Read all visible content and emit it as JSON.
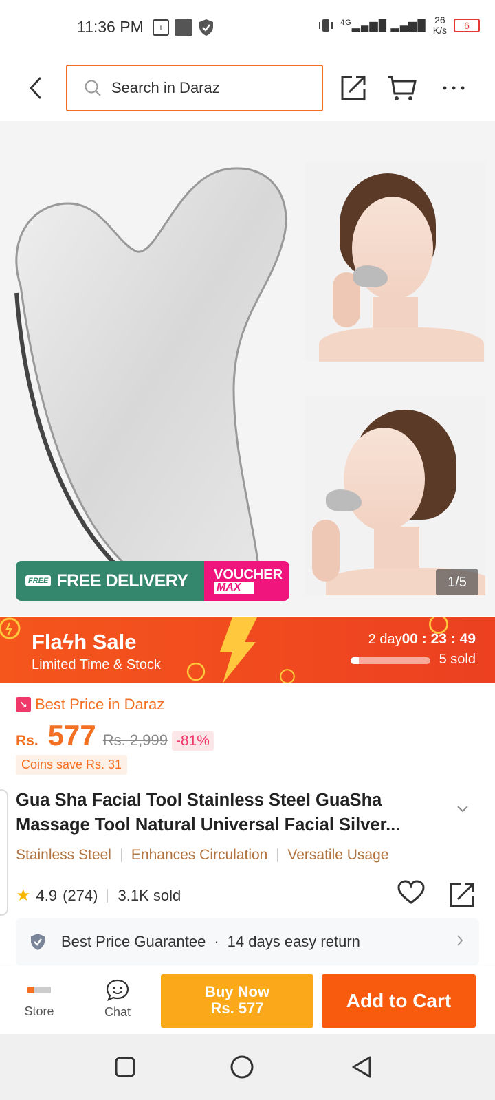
{
  "status_bar": {
    "time": "11:36 PM",
    "network": "4G",
    "speed_value": "26",
    "speed_unit": "K/s",
    "battery": "6"
  },
  "header": {
    "search_placeholder": "Search in Daraz"
  },
  "gallery": {
    "badge_free": "FREE",
    "badge_delivery": "FREE DELIVERY",
    "badge_voucher": "VOUCHER",
    "badge_max": "MAX",
    "pager": "1/5"
  },
  "flash_sale": {
    "title": "Flaϟh  Sale",
    "subtitle": "Limited Time & Stock",
    "days": "2 day",
    "timer": "00 : 23 : 49",
    "sold": "5 sold",
    "progress_fraction": 0.1
  },
  "price": {
    "best_price_label": "Best Price in Daraz",
    "currency": "Rs.",
    "value": "577",
    "original": "Rs. 2,999",
    "discount": "-81%",
    "coins": "Coins save Rs. 31"
  },
  "product": {
    "title": "Gua Sha Facial Tool Stainless Steel GuaSha Massage Tool Natural Universal Facial Silver...",
    "tags": [
      "Stainless Steel",
      "Enhances Circulation",
      "Versatile Usage"
    ],
    "rating": "4.9",
    "reviews": "(274)",
    "sold": "3.1K sold"
  },
  "guarantee": {
    "item1": "Best Price Guarantee",
    "dot": "·",
    "item2": "14 days easy return"
  },
  "actions": {
    "store": "Store",
    "chat": "Chat",
    "buy_now_line1": "Buy Now",
    "buy_now_line2": "Rs. 577",
    "add_to_cart": "Add to Cart"
  },
  "colors": {
    "accent": "#f36f21",
    "buy_now": "#fba81a",
    "add_to_cart": "#f85a0e",
    "free_delivery": "#34876c",
    "voucher": "#f0157c"
  }
}
